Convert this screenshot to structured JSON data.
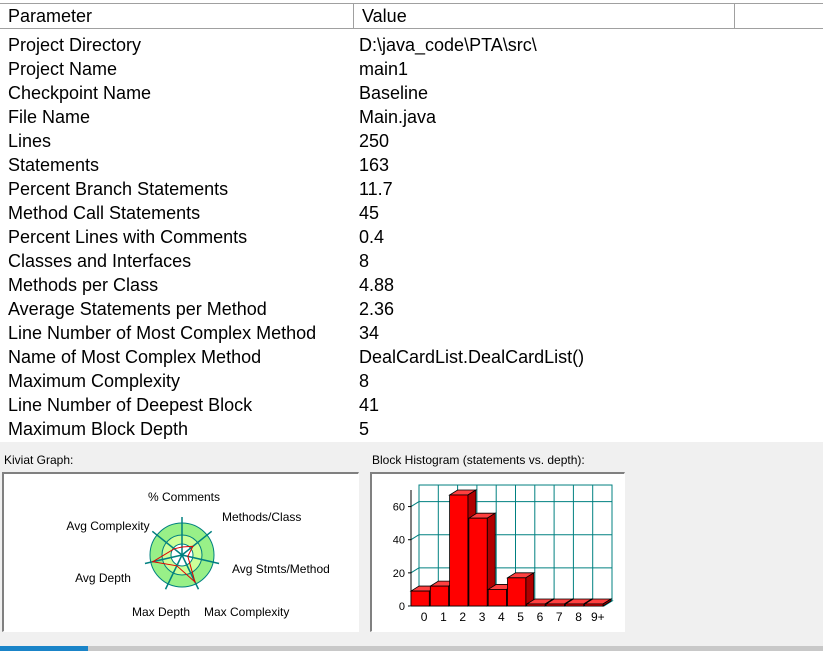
{
  "table": {
    "headers": {
      "parameter": "Parameter",
      "value": "Value"
    },
    "rows": [
      {
        "param": "Project Directory",
        "value": "D:\\java_code\\PTA\\src\\"
      },
      {
        "param": "Project Name",
        "value": "main1"
      },
      {
        "param": "Checkpoint Name",
        "value": "Baseline"
      },
      {
        "param": "File Name",
        "value": "Main.java"
      },
      {
        "param": "Lines",
        "value": "250"
      },
      {
        "param": "Statements",
        "value": "163"
      },
      {
        "param": "Percent Branch Statements",
        "value": "11.7"
      },
      {
        "param": "Method Call Statements",
        "value": "45"
      },
      {
        "param": "Percent Lines with Comments",
        "value": "0.4"
      },
      {
        "param": "Classes and Interfaces",
        "value": "8"
      },
      {
        "param": "Methods per Class",
        "value": "4.88"
      },
      {
        "param": "Average Statements per Method",
        "value": "2.36"
      },
      {
        "param": "Line Number of Most Complex Method",
        "value": "34"
      },
      {
        "param": "Name of Most Complex Method",
        "value": "DealCardList.DealCardList()"
      },
      {
        "param": "Maximum Complexity",
        "value": "8"
      },
      {
        "param": "Line Number of Deepest Block",
        "value": "41"
      },
      {
        "param": "Maximum Block Depth",
        "value": "5"
      }
    ]
  },
  "kiviat": {
    "title": "Kiviat Graph:",
    "axes": [
      "% Comments",
      "Methods/Class",
      "Avg Stmts/Method",
      "Max Complexity",
      "Max Depth",
      "Avg Depth",
      "Avg Complexity"
    ],
    "colors": {
      "outer_ring": "#98f088",
      "inner_ring": "#ccff99",
      "spokes": "#008080",
      "polygon": "#e00000"
    }
  },
  "chart_data": {
    "type": "bar",
    "title": "Block Histogram (statements vs. depth):",
    "categories": [
      "0",
      "1",
      "2",
      "3",
      "4",
      "5",
      "6",
      "7",
      "8",
      "9+"
    ],
    "values": [
      9,
      12,
      67,
      53,
      10,
      17,
      1,
      1,
      1,
      1
    ],
    "ylim": [
      0,
      70
    ],
    "yticks": [
      "0",
      "20",
      "40",
      "60"
    ],
    "grid": true,
    "bar_color": "#ff0000",
    "grid_color": "#008080"
  }
}
